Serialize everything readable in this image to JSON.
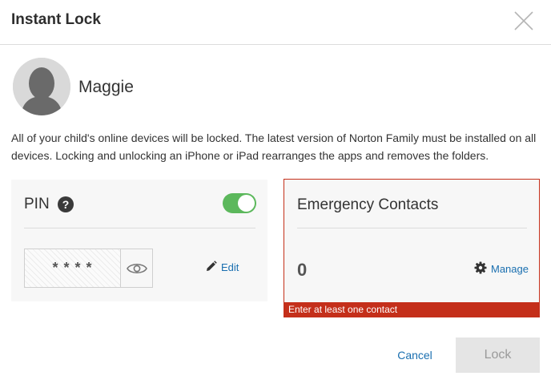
{
  "dialog": {
    "title": "Instant Lock",
    "close_icon": "close-icon"
  },
  "child": {
    "name": "Maggie",
    "avatar_icon": "default-avatar-icon"
  },
  "description": "All of your child's online devices will be locked. The latest version of Norton Family must be installed on all devices. Locking and unlocking an iPhone or iPad rearranges the apps and removes the folders.",
  "pin": {
    "label": "PIN",
    "help_icon": "question-icon",
    "help_glyph": "?",
    "enabled": true,
    "masked_value": "****",
    "show_icon": "eye-icon",
    "edit_label": "Edit",
    "edit_icon": "pencil-icon"
  },
  "emergency_contacts": {
    "title": "Emergency Contacts",
    "count": "0",
    "manage_label": "Manage",
    "manage_icon": "gear-icon",
    "error": "Enter at least one contact"
  },
  "footer": {
    "cancel_label": "Cancel",
    "lock_label": "Lock"
  },
  "colors": {
    "link": "#1a6fb0",
    "toggle_on": "#5cb85c",
    "error": "#c42f1a",
    "disabled_button": "#e5e5e5"
  }
}
